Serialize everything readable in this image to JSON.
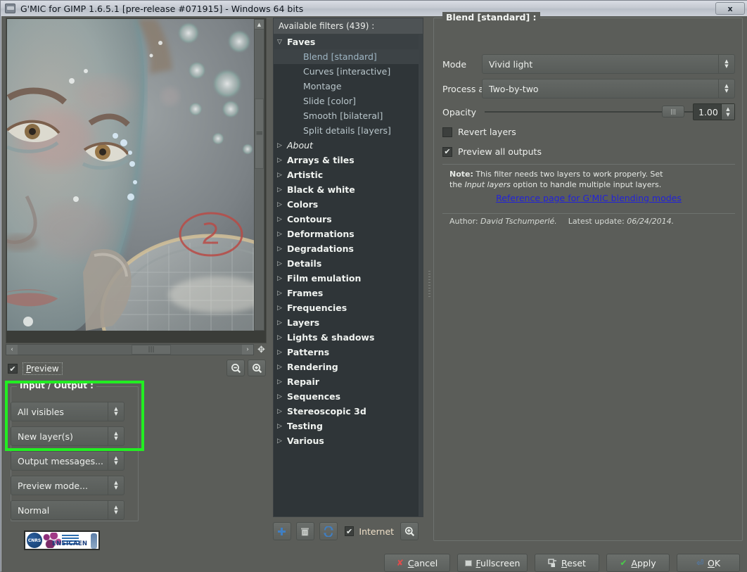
{
  "window": {
    "title": "G'MIC for GIMP 1.6.5.1 [pre-release #071915] - Windows 64 bits",
    "close_label": "x",
    "app_icon": "gmic-icon"
  },
  "preview": {
    "checkbox_checked": true,
    "label": "Preview",
    "zoom_out_icon": "zoom-out-icon",
    "zoom_in_icon": "zoom-in-icon",
    "move_icon": "move-icon",
    "hscroll_left_icon": "‹",
    "hscroll_right_icon": "›",
    "vscroll_up_icon": "▲",
    "grip": "|||"
  },
  "io_panel": {
    "title": "Input / Output :",
    "highlight_color": "#22ee22",
    "combos": [
      {
        "name": "input-layers",
        "value": "All visibles"
      },
      {
        "name": "output-mode",
        "value": "New layer(s)"
      },
      {
        "name": "output-messages",
        "value": "Output messages..."
      },
      {
        "name": "preview-mode",
        "value": "Preview mode..."
      },
      {
        "name": "preview-size",
        "value": "Normal"
      }
    ]
  },
  "logo": {
    "cnrs": "CNRS",
    "ensicaen": "ENSICAEN"
  },
  "filters": {
    "header": "Available filters (439) :",
    "tree": [
      {
        "type": "category",
        "label": "Faves",
        "expanded": true,
        "italic": false
      },
      {
        "type": "leaf",
        "label": "Blend [standard]",
        "selected": true
      },
      {
        "type": "leaf",
        "label": "Curves [interactive]",
        "selected": false
      },
      {
        "type": "leaf",
        "label": "Montage",
        "selected": false
      },
      {
        "type": "leaf",
        "label": "Slide [color]",
        "selected": false
      },
      {
        "type": "leaf",
        "label": "Smooth [bilateral]",
        "selected": false
      },
      {
        "type": "leaf",
        "label": "Split details [layers]",
        "selected": false
      },
      {
        "type": "category",
        "label": "About",
        "expanded": false,
        "italic": true
      },
      {
        "type": "category",
        "label": "Arrays & tiles",
        "expanded": false,
        "italic": false
      },
      {
        "type": "category",
        "label": "Artistic",
        "expanded": false,
        "italic": false
      },
      {
        "type": "category",
        "label": "Black & white",
        "expanded": false,
        "italic": false
      },
      {
        "type": "category",
        "label": "Colors",
        "expanded": false,
        "italic": false
      },
      {
        "type": "category",
        "label": "Contours",
        "expanded": false,
        "italic": false
      },
      {
        "type": "category",
        "label": "Deformations",
        "expanded": false,
        "italic": false
      },
      {
        "type": "category",
        "label": "Degradations",
        "expanded": false,
        "italic": false
      },
      {
        "type": "category",
        "label": "Details",
        "expanded": false,
        "italic": false
      },
      {
        "type": "category",
        "label": "Film emulation",
        "expanded": false,
        "italic": false
      },
      {
        "type": "category",
        "label": "Frames",
        "expanded": false,
        "italic": false
      },
      {
        "type": "category",
        "label": "Frequencies",
        "expanded": false,
        "italic": false
      },
      {
        "type": "category",
        "label": "Layers",
        "expanded": false,
        "italic": false
      },
      {
        "type": "category",
        "label": "Lights & shadows",
        "expanded": false,
        "italic": false
      },
      {
        "type": "category",
        "label": "Patterns",
        "expanded": false,
        "italic": false
      },
      {
        "type": "category",
        "label": "Rendering",
        "expanded": false,
        "italic": false
      },
      {
        "type": "category",
        "label": "Repair",
        "expanded": false,
        "italic": false
      },
      {
        "type": "category",
        "label": "Sequences",
        "expanded": false,
        "italic": false
      },
      {
        "type": "category",
        "label": "Stereoscopic 3d",
        "expanded": false,
        "italic": false
      },
      {
        "type": "category",
        "label": "Testing",
        "expanded": false,
        "italic": false
      },
      {
        "type": "category",
        "label": "Various",
        "expanded": false,
        "italic": false
      }
    ],
    "toolbar": {
      "add_icon": "plus-icon",
      "delete_icon": "trash-icon",
      "refresh_icon": "refresh-icon",
      "internet_checked": true,
      "internet_label": "Internet",
      "search_icon": "zoom-search-icon"
    }
  },
  "filter_panel": {
    "title": "Blend [standard] :",
    "mode_label": "Mode",
    "mode_value": "Vivid light",
    "process_label": "Process as",
    "process_value": "Two-by-two",
    "opacity_label": "Opacity",
    "opacity_value": "1.00",
    "opacity_fraction": 0.92,
    "revert_label": "Revert layers",
    "revert_checked": false,
    "preview_all_label": "Preview all outputs",
    "preview_all_checked": true,
    "note_prefix": "Note:",
    "note_line1": " This filter needs two layers to work properly. Set",
    "note_line2_a": "the ",
    "note_line2_i": "Input layers",
    "note_line2_b": " option to handle multiple input layers.",
    "link_text": "Reference page for G'MIC blending modes",
    "link_color": "#2323d8",
    "author_label": "Author:",
    "author_name": "David Tschumperlé.",
    "update_label": "Latest update:",
    "update_value": "06/24/2014."
  },
  "buttons": {
    "cancel": "Cancel",
    "fullscreen": "Fullscreen",
    "reset": "Reset",
    "apply": "Apply",
    "ok": "OK"
  }
}
